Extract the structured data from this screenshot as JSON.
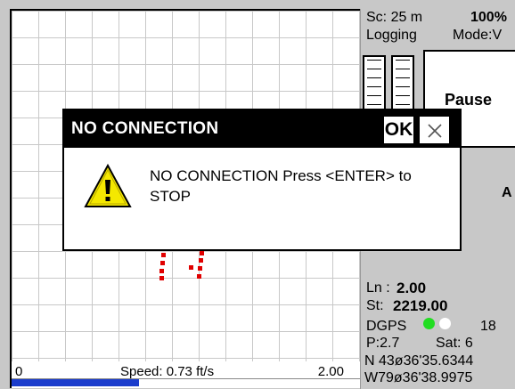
{
  "map": {
    "track_color": "#e00000"
  },
  "speedbar": {
    "min_label": "0",
    "speed_text": "Speed: 0.73 ft/s",
    "max_label": "2.00",
    "fill_fraction": 0.365,
    "fill_color": "#1a3ccc"
  },
  "panel": {
    "scale": "Sc:  25 m",
    "zoom": "100%",
    "logging": "Logging",
    "mode": "Mode:V",
    "pause_label": "Pause",
    "partial_letter": "A",
    "ln_label": "Ln :",
    "ln_value": "2.00",
    "st_label": "St:",
    "st_value": "2219.00",
    "dgps_label": "DGPS",
    "dgps_value": "18",
    "dot_green": "#22dd22",
    "dot_white": "#ffffff",
    "p_value": "P:2.7",
    "sat_value": "Sat:  6",
    "latitude": "N 43ø36'35.6344",
    "longitude": "W79ø36'38.9975"
  },
  "dialog": {
    "title": "NO CONNECTION",
    "ok_label": "OK",
    "message": "NO CONNECTION Press <ENTER> to STOP",
    "icon": "warning-icon",
    "close_icon": "close-icon"
  }
}
